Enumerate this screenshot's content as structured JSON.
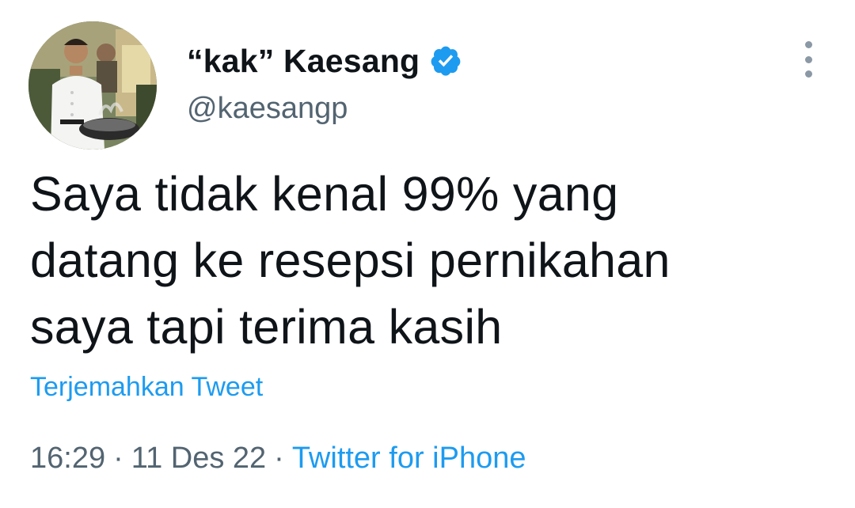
{
  "user": {
    "display_name": "“kak” Kaesang",
    "handle": "@kaesangp",
    "verified": true,
    "avatar_icon": "profile-photo-chef-cooking"
  },
  "tweet": {
    "lines": [
      "Saya tidak kenal 99% yang",
      "datang ke resepsi pernikahan",
      "saya tapi terima kasih"
    ],
    "translate_label": "Terjemahkan Tweet"
  },
  "meta": {
    "time": "16:29",
    "separator": "·",
    "date": "11 Des 22",
    "source": "Twitter for iPhone"
  },
  "menu": {
    "icon": "more-vertical-icon"
  },
  "colors": {
    "text": "#0f1419",
    "secondary": "#536471",
    "accent": "#1d9bf0"
  }
}
